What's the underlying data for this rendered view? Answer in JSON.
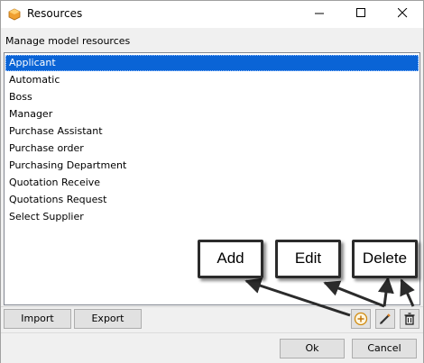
{
  "window": {
    "title": "Resources",
    "controls": [
      "minimize",
      "maximize",
      "close"
    ]
  },
  "section_label": "Manage model resources",
  "resources": [
    {
      "label": "Applicant",
      "selected": true
    },
    {
      "label": "Automatic",
      "selected": false
    },
    {
      "label": "Boss",
      "selected": false
    },
    {
      "label": "Manager",
      "selected": false
    },
    {
      "label": "Purchase Assistant",
      "selected": false
    },
    {
      "label": "Purchase order",
      "selected": false
    },
    {
      "label": "Purchasing Department",
      "selected": false
    },
    {
      "label": "Quotation Receive",
      "selected": false
    },
    {
      "label": "Quotations Request",
      "selected": false
    },
    {
      "label": "Select Supplier",
      "selected": false
    }
  ],
  "toolbar": {
    "import_label": "Import",
    "export_label": "Export",
    "icons": [
      "add-icon",
      "edit-icon",
      "delete-icon"
    ]
  },
  "footer": {
    "ok_label": "Ok",
    "cancel_label": "Cancel"
  },
  "callouts": {
    "add": "Add",
    "edit": "Edit",
    "delete": "Delete"
  },
  "colors": {
    "selection": "#0a64d6",
    "app_icon": "#f0a030"
  }
}
